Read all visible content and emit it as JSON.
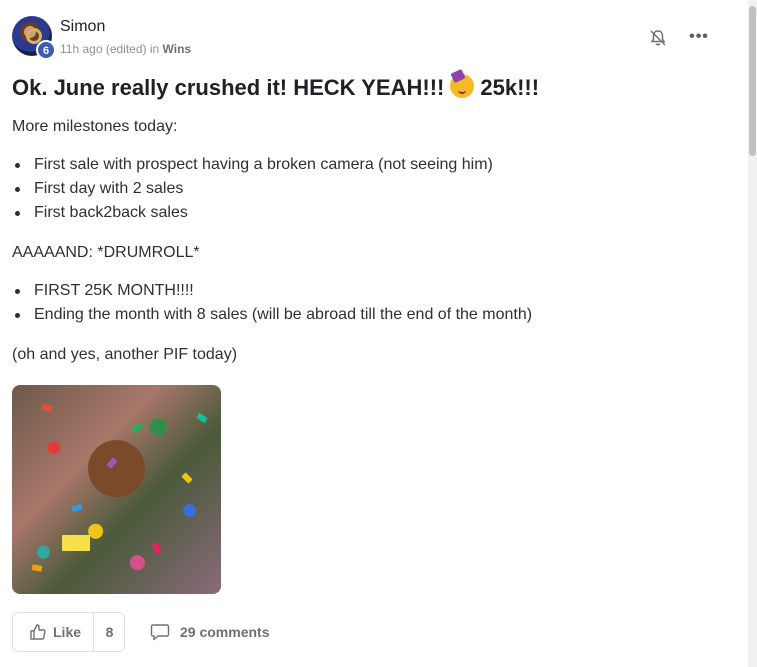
{
  "post": {
    "author": "Simon",
    "level": "6",
    "meta_time": "11h ago (edited) in ",
    "category": "Wins",
    "title_before": "Ok. June really crushed it! HECK YEAH!!!",
    "title_emoji": "partying-face-emoji",
    "title_after": "25k!!!",
    "intro": "More milestones today:",
    "list1": [
      "First sale with prospect having a broken camera (not seeing him)",
      "First day with 2 sales",
      "First back2back sales"
    ],
    "announce": "AAAAAND: *DRUMROLL*",
    "list2": [
      "FIRST 25K MONTH!!!!",
      "Ending the month with 8 sales (will be abroad till the end of the month)"
    ],
    "closing": "(oh and yes, another PIF today)",
    "media": "confetti-celebration-gif",
    "actions": {
      "like_label": "Like",
      "like_count": "8",
      "comments_label": "29 comments"
    }
  },
  "icons": {
    "bell": "bell-off-icon",
    "more": "more-options-icon",
    "like": "thumbs-up-icon",
    "comment": "comment-icon"
  }
}
